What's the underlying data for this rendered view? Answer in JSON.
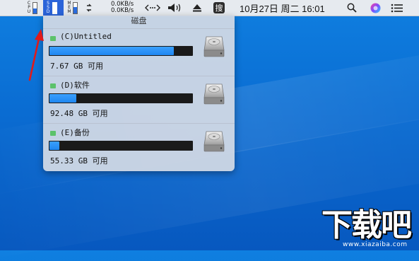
{
  "menubar": {
    "stats": [
      {
        "name": "cpu",
        "label": [
          "C",
          "P",
          "U"
        ],
        "level": 0.45,
        "active": false
      },
      {
        "name": "ssd",
        "label": [
          "S",
          "S",
          "D"
        ],
        "level": 0.9,
        "active": true
      },
      {
        "name": "mem",
        "label": [
          "M",
          "E",
          "M"
        ],
        "level": 0.55,
        "active": false
      }
    ],
    "net_up": "0.0KB/s",
    "net_down": "0.0KB/s",
    "sou_label": "搜",
    "clock": "10月27日 周二 16:01",
    "icons": [
      "swap-icon",
      "network-icon",
      "volume-icon",
      "eject-icon",
      "search-app-icon",
      "spotlight-icon",
      "siri-icon",
      "control-center-icon"
    ]
  },
  "panel": {
    "title": "磁盘",
    "drives": [
      {
        "name": "(C)Untitled",
        "free": "7.67 GB 可用",
        "used_fraction": 0.87,
        "led_color": "#5cc26b"
      },
      {
        "name": "(D)软件",
        "free": "92.48 GB 可用",
        "used_fraction": 0.19,
        "led_color": "#5cc26b"
      },
      {
        "name": "(E)备份",
        "free": "55.33 GB 可用",
        "used_fraction": 0.07,
        "led_color": "#5cc26b"
      }
    ]
  },
  "watermark": {
    "brand": "下载吧",
    "url": "www.xiazaiba.com"
  },
  "colors": {
    "accent": "#1f86f0",
    "wallpaper": "#0a6cd2",
    "arrow": "#e01a1a"
  }
}
